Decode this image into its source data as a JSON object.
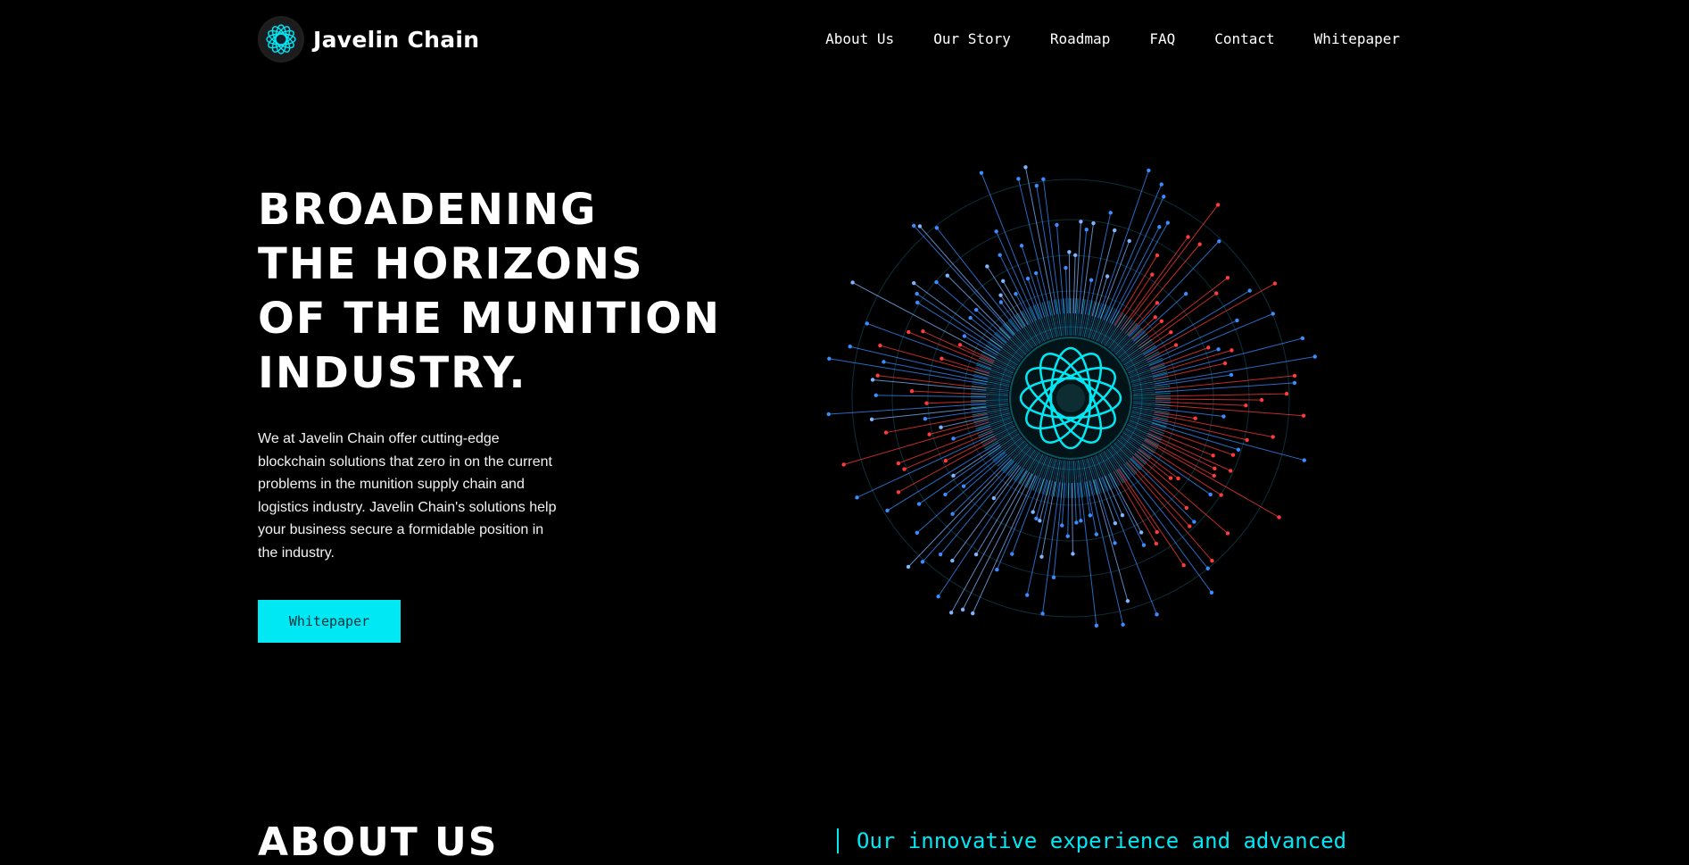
{
  "brand": {
    "name": "Javelin Chain",
    "logo_icon": "atom-rosette-icon",
    "accent": "#00e8f4"
  },
  "nav": {
    "items": [
      {
        "label": "About Us"
      },
      {
        "label": "Our Story"
      },
      {
        "label": "Roadmap"
      },
      {
        "label": "FAQ"
      },
      {
        "label": "Contact"
      },
      {
        "label": "Whitepaper"
      }
    ]
  },
  "hero": {
    "title_lines": [
      "BROADENING",
      "THE HORIZONS",
      "OF THE MUNITION",
      "INDUSTRY."
    ],
    "description": "We at Javelin Chain offer cutting-edge blockchain solutions that zero in on the current problems in the munition supply chain and logistics industry. Javelin Chain's solutions help your business secure a formidable position in the industry.",
    "cta_label": "Whitepaper",
    "visual": {
      "icon": "radial-data-burst-icon",
      "colors": [
        "#00e8f4",
        "#3a8cff",
        "#ff3b3b"
      ]
    }
  },
  "about": {
    "title": "ABOUT US",
    "quote": "Our innovative experience and advanced"
  }
}
